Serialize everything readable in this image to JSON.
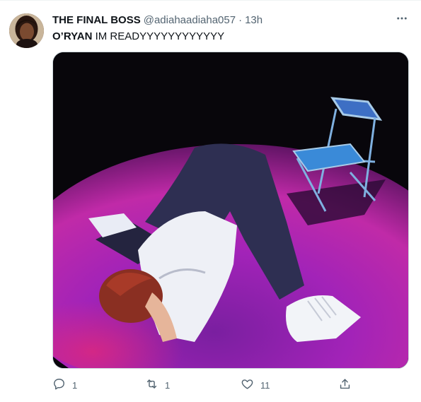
{
  "tweet": {
    "display_name": "THE FINAL BOSS",
    "handle": "@adiahaadiaha057",
    "separator": "·",
    "time": "13h",
    "mention": "O’RYAN",
    "text": " IM READYYYYYYYYYYYY",
    "media_description": "",
    "actions": {
      "reply_count": "1",
      "retweet_count": "1",
      "like_count": "11"
    }
  },
  "icons": {
    "more": "more-horizontal-icon",
    "reply": "reply-icon",
    "retweet": "retweet-icon",
    "like": "heart-icon",
    "share": "share-icon"
  },
  "colors": {
    "secondary_text": "#536471",
    "primary_text": "#0f1419",
    "border": "#cfd9de"
  }
}
